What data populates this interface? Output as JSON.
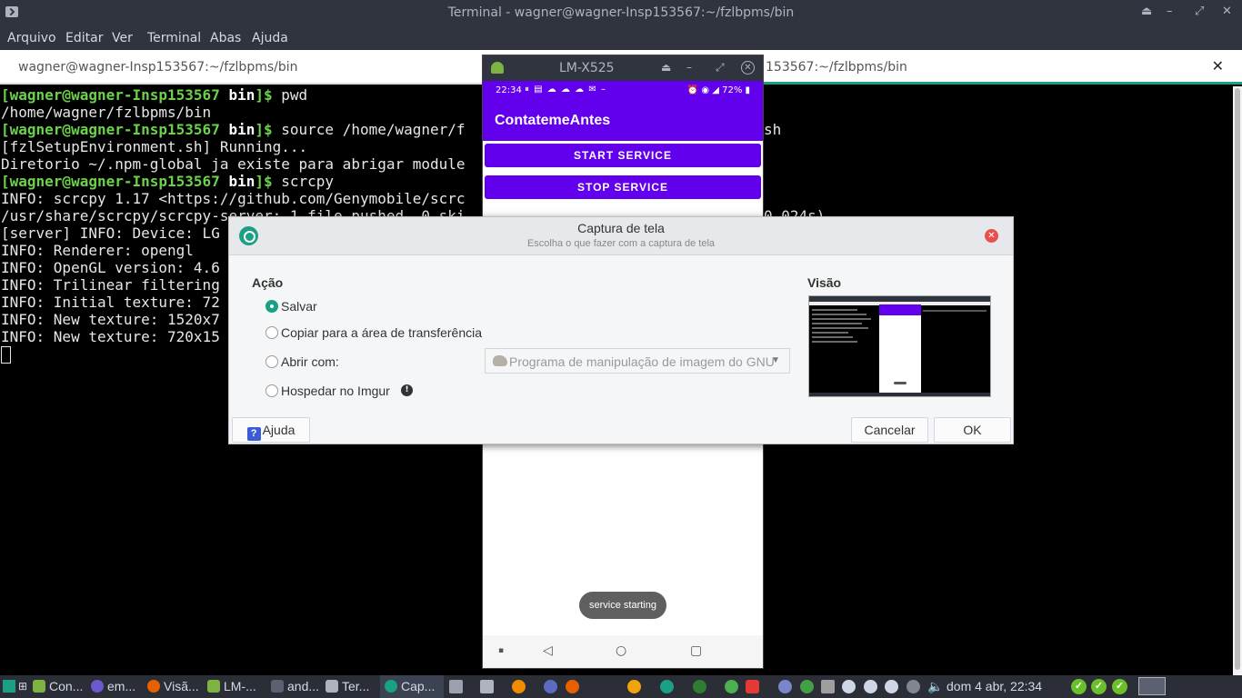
{
  "terminal": {
    "window_title": "Terminal - wagner@wagner-Insp153567:~/fzlbpms/bin",
    "menu": [
      "Arquivo",
      "Editar",
      "Ver",
      "Terminal",
      "Abas",
      "Ajuda"
    ],
    "tab_left_title": "wagner@wagner-Insp153567:~/fzlbpms/bin",
    "tab_right_title": "153567:~/fzlbpms/bin",
    "prompt_user": "[wagner@wagner-Insp153567",
    "prompt_dir": " bin",
    "prompt_end": "]$ ",
    "cmd_pwd": "pwd",
    "line_pwd_output": "/home/wagner/fzlbpms/bin",
    "cmd_source_a": "source /home/wagner/f",
    "cmd_source_b": "sh",
    "line_setup": "[fzlSetupEnvironment.sh] Running...",
    "line_npm": "Diretorio ~/.npm-global ja existe para abrigar module",
    "cmd_scrcpy": "scrcpy",
    "line_scrcpy_ver": "INFO: scrcpy 1.17 <https://github.com/Genymobile/scrc",
    "line_push_a": "/usr/share/scrcpy/scrcpy-server: 1 file pushed. 0 ski",
    "line_push_b": "0.024s)",
    "line_device": "[server] INFO: Device: LG",
    "line_renderer": "INFO: Renderer: opengl",
    "line_opengl": "INFO: OpenGL version: 4.6",
    "line_trilinear": "INFO: Trilinear filtering",
    "line_initial": "INFO: Initial texture: 72",
    "line_new1": "INFO: New texture: 1520x7",
    "line_new2": "INFO: New texture: 720x15"
  },
  "phone": {
    "window_title": "LM-X525",
    "status_time": "22:34",
    "status_notifs": "⏸ ▤ ☁ ☁ ☁ ✉ –",
    "status_right": "⏰ ◉ ◢ 72% ▮",
    "app_title": "ContatemeAntes",
    "start_button": "START SERVICE",
    "stop_button": "STOP SERVICE",
    "toast": "service starting"
  },
  "dialog": {
    "title": "Captura de tela",
    "subtitle": "Escolha o que fazer com a captura de tela",
    "action_heading": "Ação",
    "preview_heading": "Visão",
    "options": {
      "save": "Salvar",
      "copy": "Copiar para a área de transferência",
      "open_with": "Abrir com:",
      "imgur": "Hospedar no Imgur"
    },
    "open_with_app": "Programa de manipulação de imagem do GNU",
    "help_button": "Ajuda",
    "cancel_button": "Cancelar",
    "ok_button": "OK"
  },
  "taskbar": {
    "items": [
      "Con...",
      "em...",
      "Visã...",
      "LM-...",
      "and...",
      "Ter...",
      "Cap..."
    ],
    "clock": "dom  4 abr, 22:34"
  },
  "colors": {
    "accent_teal": "#1aa085",
    "android_purple": "#6200ee",
    "prompt_green": "#6bd24a",
    "titlebar": "#2f343f"
  }
}
